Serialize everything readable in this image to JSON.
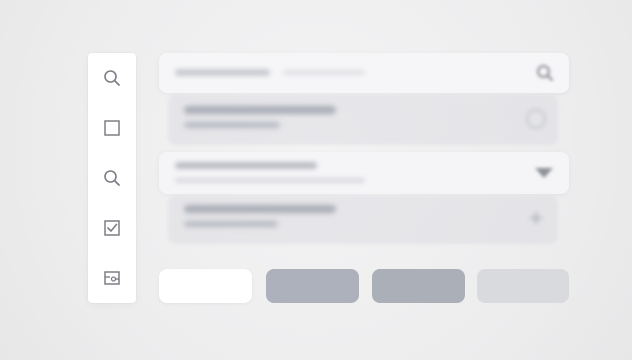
{
  "rail": {
    "icons": [
      "search-icon",
      "square-icon",
      "search-icon",
      "checkbox-icon",
      "card-icon"
    ]
  },
  "search_bar": {
    "placeholder": ""
  },
  "dropdown": {
    "icon": "chevron-down-icon"
  },
  "buttons": [
    {
      "style": "white"
    },
    {
      "style": "gray"
    },
    {
      "style": "gray"
    },
    {
      "style": "light-gray"
    }
  ],
  "colors": {
    "background": "#efeff0",
    "panel": "#f6f6f8",
    "button_gray": "#adb1bb",
    "button_light": "#d9dadd",
    "icon": "#7d7f86"
  }
}
